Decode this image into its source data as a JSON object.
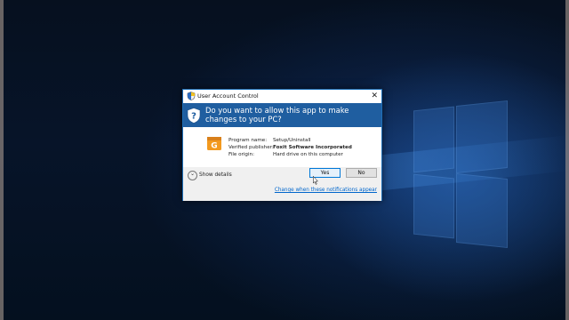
{
  "dialog": {
    "title": "User Account Control",
    "close_symbol": "✕",
    "question": "Do you want to allow this app to make changes to your PC?",
    "fields": [
      {
        "label": "Program name:",
        "value": "Setup/Uninstall"
      },
      {
        "label": "Verified publisher:",
        "value": "Foxit Software Incorporated"
      },
      {
        "label": "File origin:",
        "value": "Hard drive on this computer"
      }
    ],
    "show_details": "Show details",
    "yes_label": "Yes",
    "no_label": "No",
    "change_link": "Change when these notifications appear"
  },
  "colors": {
    "banner": "#1f5ea0",
    "accent": "#0078d7",
    "app_icon": "#f39a1e"
  },
  "icons": {
    "shield": "uac-shield-icon",
    "app": "foxit-app-icon",
    "chevron": "chevron-down-icon",
    "close": "close-icon",
    "cursor": "mouse-cursor-icon"
  }
}
